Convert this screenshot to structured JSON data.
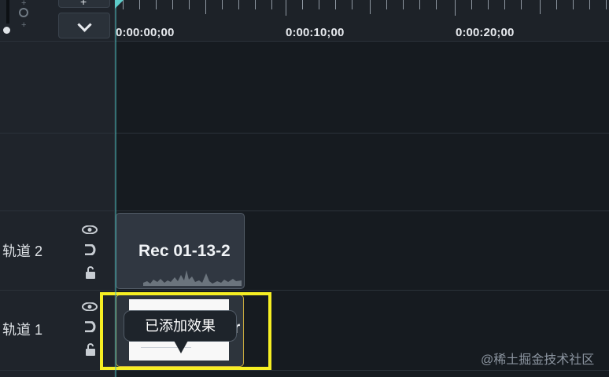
{
  "ruler": {
    "timecodes": [
      "0:00:00;00",
      "0:00:10;00",
      "0:00:20;00"
    ]
  },
  "tracks": [
    {
      "label": "轨道 2",
      "eye_icon": "eye-icon",
      "magnet_icon": "magnet-icon",
      "lock_icon": "unlock-icon"
    },
    {
      "label": "轨道 1",
      "eye_icon": "eye-icon",
      "magnet_icon": "magnet-icon",
      "lock_icon": "unlock-icon"
    }
  ],
  "clips": {
    "audio_title": "Rec 01-13-2",
    "video_partial_text": "r"
  },
  "tooltip": {
    "text": "已添加效果"
  },
  "watermark": "@稀土掘金技术社区",
  "controls": {
    "zoom_plus": "+",
    "zoom_icon": "search-icon",
    "collapse_icon": "chevron-down-icon"
  },
  "colors": {
    "highlight": "#f6ef23",
    "playhead": "#5dcbc9",
    "selected_clip_border": "#c6a93e"
  }
}
